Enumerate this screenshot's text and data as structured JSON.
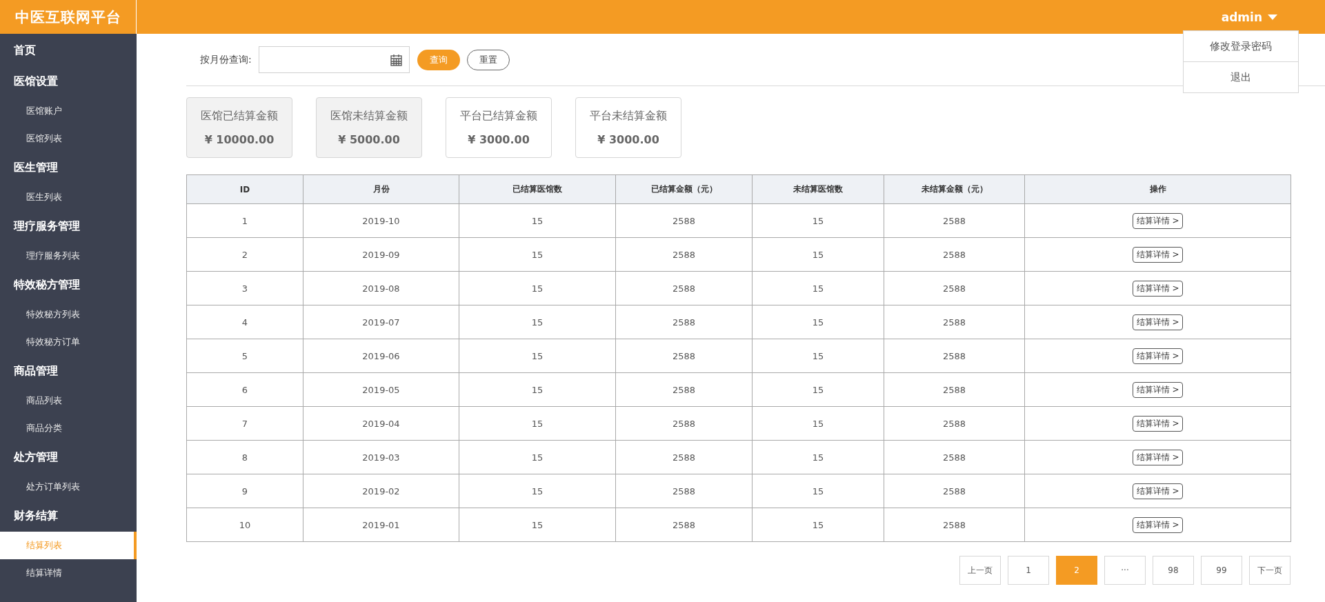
{
  "brand": "中医互联网平台",
  "user": {
    "name": "admin",
    "menu": [
      "修改登录密码",
      "退出"
    ]
  },
  "sidebar": {
    "items": [
      {
        "label": "首页",
        "selected": false
      },
      {
        "label": "医馆设置",
        "selected": false,
        "children": [
          {
            "label": "医馆账户",
            "selected": false
          },
          {
            "label": "医馆列表",
            "selected": false
          }
        ]
      },
      {
        "label": "医生管理",
        "selected": false,
        "children": [
          {
            "label": "医生列表",
            "selected": false
          }
        ]
      },
      {
        "label": "理疗服务管理",
        "selected": false,
        "children": [
          {
            "label": "理疗服务列表",
            "selected": false
          }
        ]
      },
      {
        "label": "特效秘方管理",
        "selected": false,
        "children": [
          {
            "label": "特效秘方列表",
            "selected": false
          },
          {
            "label": "特效秘方订单",
            "selected": false
          }
        ]
      },
      {
        "label": "商品管理",
        "selected": false,
        "children": [
          {
            "label": "商品列表",
            "selected": false
          },
          {
            "label": "商品分类",
            "selected": false
          }
        ]
      },
      {
        "label": "处方管理",
        "selected": false,
        "children": [
          {
            "label": "处方订单列表",
            "selected": false
          }
        ]
      },
      {
        "label": "财务结算",
        "selected": false,
        "children": [
          {
            "label": "结算列表",
            "selected": true
          },
          {
            "label": "结算详情",
            "selected": false
          }
        ]
      }
    ]
  },
  "filter": {
    "label": "按月份查询:",
    "query_button": "查询",
    "reset_button": "重置"
  },
  "cards": [
    {
      "title": "医馆已结算金额",
      "amount": "¥ 10000.00",
      "shaded": true
    },
    {
      "title": "医馆未结算金额",
      "amount": "¥ 5000.00",
      "shaded": true
    },
    {
      "title": "平台已结算金额",
      "amount": "¥ 3000.00",
      "shaded": false
    },
    {
      "title": "平台未结算金额",
      "amount": "¥ 3000.00",
      "shaded": false
    }
  ],
  "table": {
    "columns": [
      "ID",
      "月份",
      "已结算医馆数",
      "已结算金额（元）",
      "未结算医馆数",
      "未结算金额（元）",
      "操作"
    ],
    "rows": [
      [
        "1",
        "2019-10",
        "15",
        "2588",
        "15",
        "2588",
        "结算详情 >"
      ],
      [
        "2",
        "2019-09",
        "15",
        "2588",
        "15",
        "2588",
        "结算详情 >"
      ],
      [
        "3",
        "2019-08",
        "15",
        "2588",
        "15",
        "2588",
        "结算详情 >"
      ],
      [
        "4",
        "2019-07",
        "15",
        "2588",
        "15",
        "2588",
        "结算详情 >"
      ],
      [
        "5",
        "2019-06",
        "15",
        "2588",
        "15",
        "2588",
        "结算详情 >"
      ],
      [
        "6",
        "2019-05",
        "15",
        "2588",
        "15",
        "2588",
        "结算详情 >"
      ],
      [
        "7",
        "2019-04",
        "15",
        "2588",
        "15",
        "2588",
        "结算详情 >"
      ],
      [
        "8",
        "2019-03",
        "15",
        "2588",
        "15",
        "2588",
        "结算详情 >"
      ],
      [
        "9",
        "2019-02",
        "15",
        "2588",
        "15",
        "2588",
        "结算详情 >"
      ],
      [
        "10",
        "2019-01",
        "15",
        "2588",
        "15",
        "2588",
        "结算详情 >"
      ]
    ]
  },
  "pagination": [
    {
      "label": "上一页",
      "selected": false
    },
    {
      "label": "1",
      "selected": false
    },
    {
      "label": "2",
      "selected": true
    },
    {
      "label": "···",
      "selected": false
    },
    {
      "label": "98",
      "selected": false
    },
    {
      "label": "99",
      "selected": false
    },
    {
      "label": "下一页",
      "selected": false
    }
  ]
}
